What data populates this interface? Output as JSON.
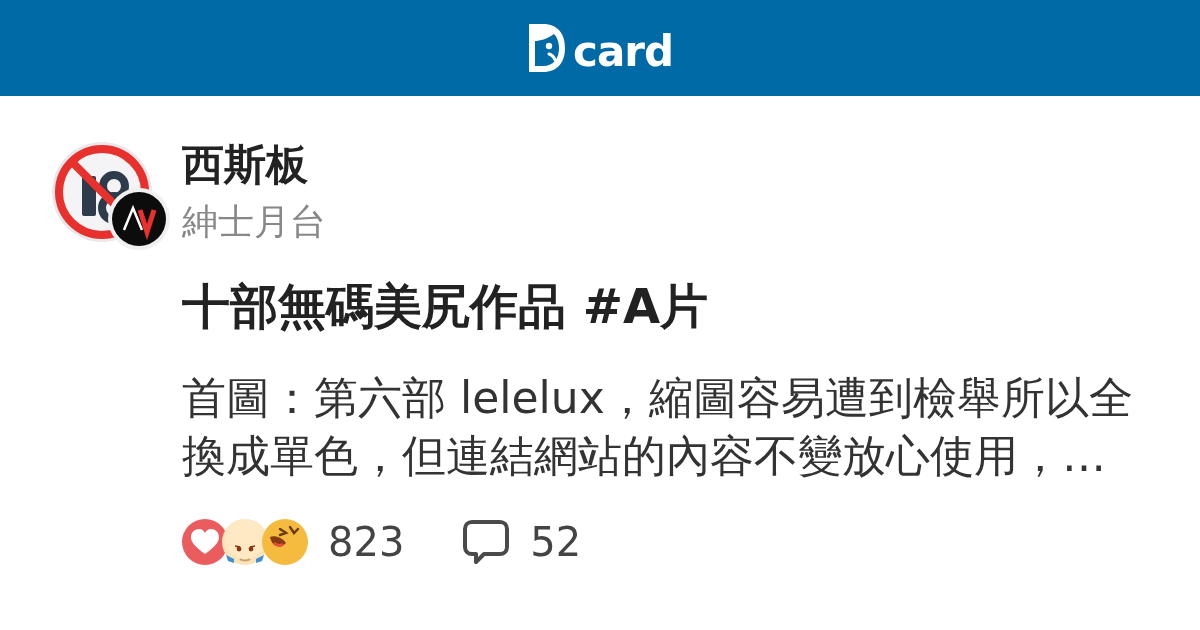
{
  "header": {
    "logo_text": "card"
  },
  "post": {
    "board": {
      "name": "西斯板",
      "subtitle": "紳士月台"
    },
    "title": "十部無碼美尻作品 #A片",
    "excerpt": "首圖：第六部 lelelux，縮圖容易遭到檢舉所以全換成單色，但連結網站的內容不變放心使用，…",
    "reactions": [
      {
        "kind": "heart"
      },
      {
        "kind": "crying"
      },
      {
        "kind": "laughing"
      }
    ],
    "reaction_count": "823",
    "comment_count": "52"
  }
}
